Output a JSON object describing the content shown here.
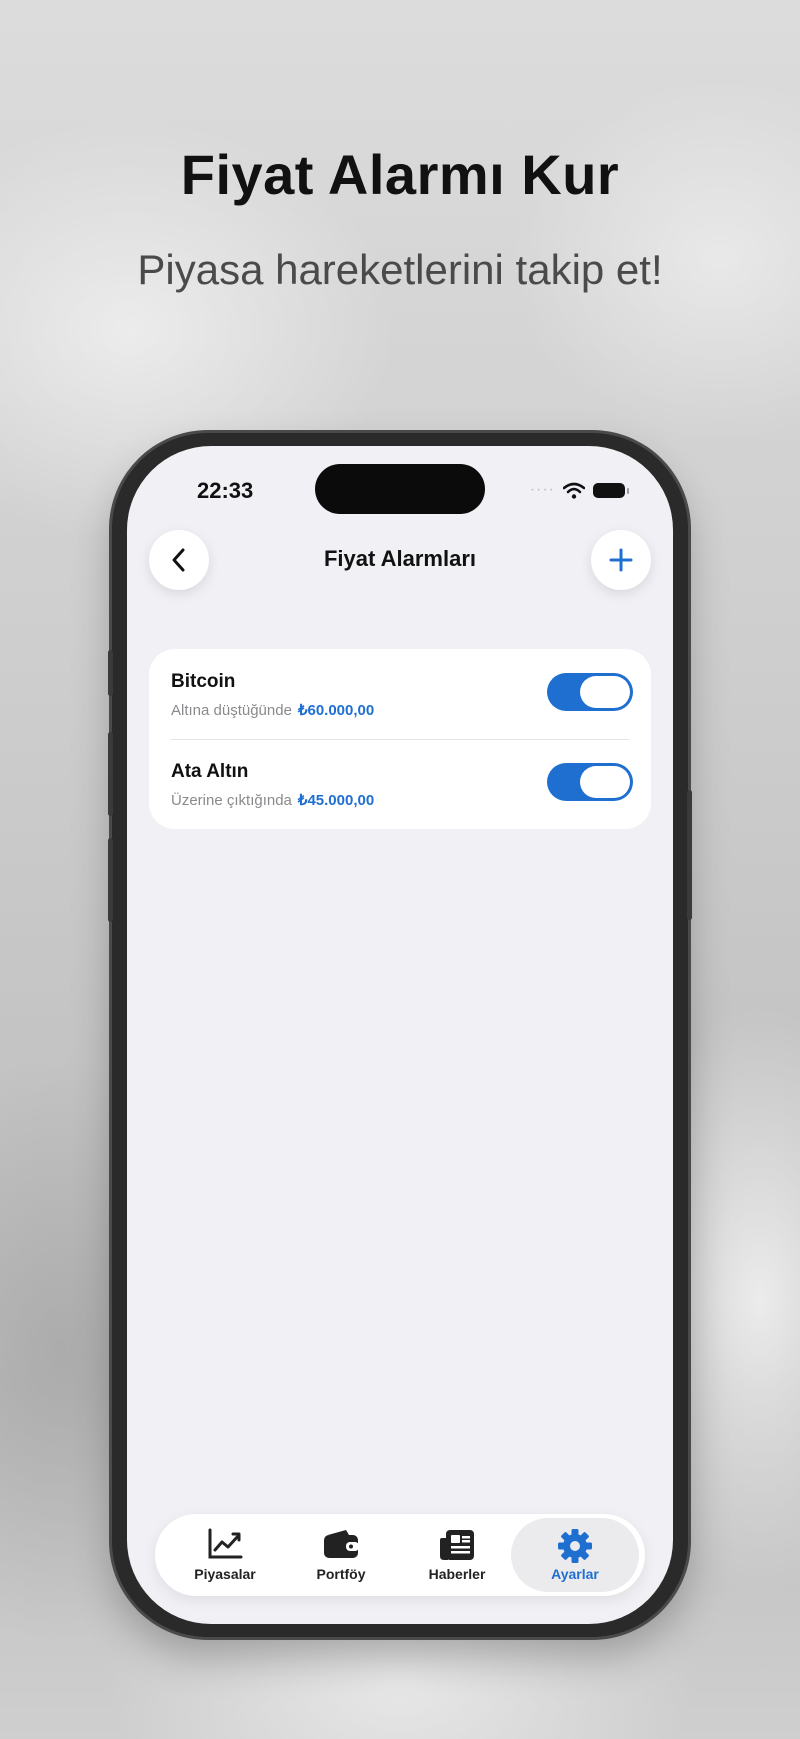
{
  "promo": {
    "headline": "Fiyat Alarmı Kur",
    "subline": "Piyasa hareketlerini takip et!"
  },
  "status_bar": {
    "time": "22:33"
  },
  "nav": {
    "title": "Fiyat Alarmları"
  },
  "alarms": [
    {
      "name": "Bitcoin",
      "condition": "Altına düştüğünde",
      "amount": "₺60.000,00",
      "enabled": true
    },
    {
      "name": "Ata Altın",
      "condition": "Üzerine çıktığında",
      "amount": "₺45.000,00",
      "enabled": true
    }
  ],
  "tabs": [
    {
      "label": "Piyasalar",
      "icon": "chart-line-icon",
      "active": false
    },
    {
      "label": "Portföy",
      "icon": "wallet-icon",
      "active": false
    },
    {
      "label": "Haberler",
      "icon": "newspaper-icon",
      "active": false
    },
    {
      "label": "Ayarlar",
      "icon": "gear-icon",
      "active": true
    }
  ],
  "colors": {
    "accent": "#1f6fd1",
    "screen_bg": "#f1f1f5",
    "card_bg": "#ffffff"
  }
}
